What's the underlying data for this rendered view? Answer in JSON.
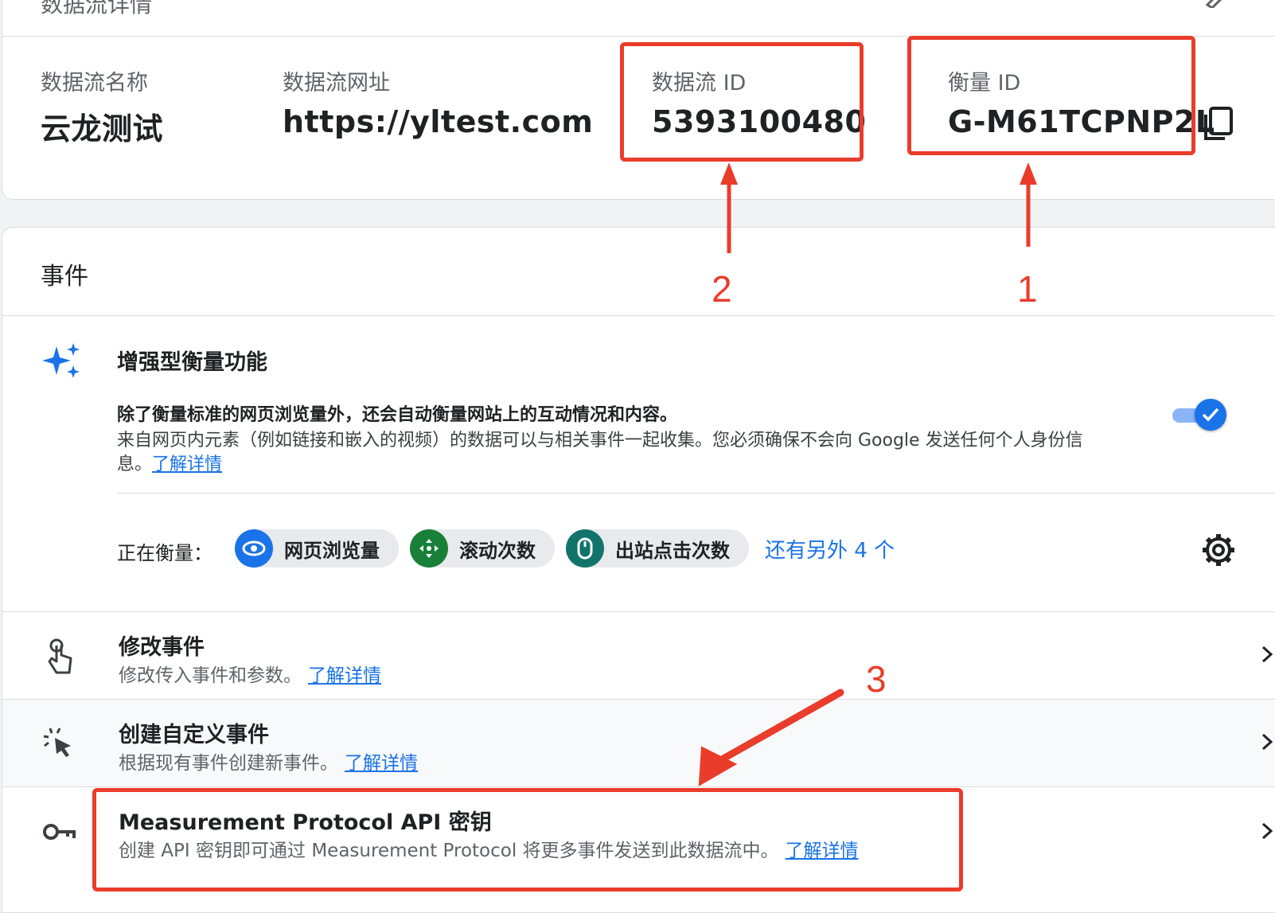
{
  "top_card": {
    "partial_title": "数据流详情",
    "stream_name": {
      "label": "数据流名称",
      "value": "云龙测试"
    },
    "stream_url": {
      "label": "数据流网址",
      "value": "https://yltest.com"
    },
    "stream_id": {
      "label": "数据流 ID",
      "value": "5393100480"
    },
    "measurement_id": {
      "label": "衡量 ID",
      "value": "G-M61TCPNP2L"
    }
  },
  "annotations": {
    "one": "1",
    "two": "2",
    "three": "3"
  },
  "events": {
    "title": "事件",
    "enhanced": {
      "title": "增强型衡量功能",
      "line1": "除了衡量标准的网页浏览量外，还会自动衡量网站上的互动情况和内容。",
      "line2": "来自网页内元素（例如链接和嵌入的视频）的数据可以与相关事件一起收集。您必须确保不会向 Google 发送任何个人身份信",
      "line3": "息。",
      "learn_more": "了解详情",
      "toggle_on": true
    },
    "measuring": {
      "label": "正在衡量：",
      "chips": [
        {
          "label": "网页浏览量",
          "icon": "eye-icon",
          "color": "#1a73e8"
        },
        {
          "label": "滚动次数",
          "icon": "scroll-icon",
          "color": "#188038"
        },
        {
          "label": "出站点击次数",
          "icon": "mouse-icon",
          "color": "#12736b"
        }
      ],
      "more": "还有另外 4 个"
    },
    "rows": [
      {
        "title": "修改事件",
        "subtitle": "修改传入事件和参数。",
        "link": "了解详情"
      },
      {
        "title": "创建自定义事件",
        "subtitle": "根据现有事件创建新事件。",
        "link": "了解详情"
      },
      {
        "title": "Measurement Protocol API 密钥",
        "subtitle": "创建 API 密钥即可通过 Measurement Protocol 将更多事件发送到此数据流中。",
        "link": "了解详情"
      }
    ]
  },
  "colors": {
    "annotation": "#ea3c2b",
    "link": "#1a73e8"
  }
}
